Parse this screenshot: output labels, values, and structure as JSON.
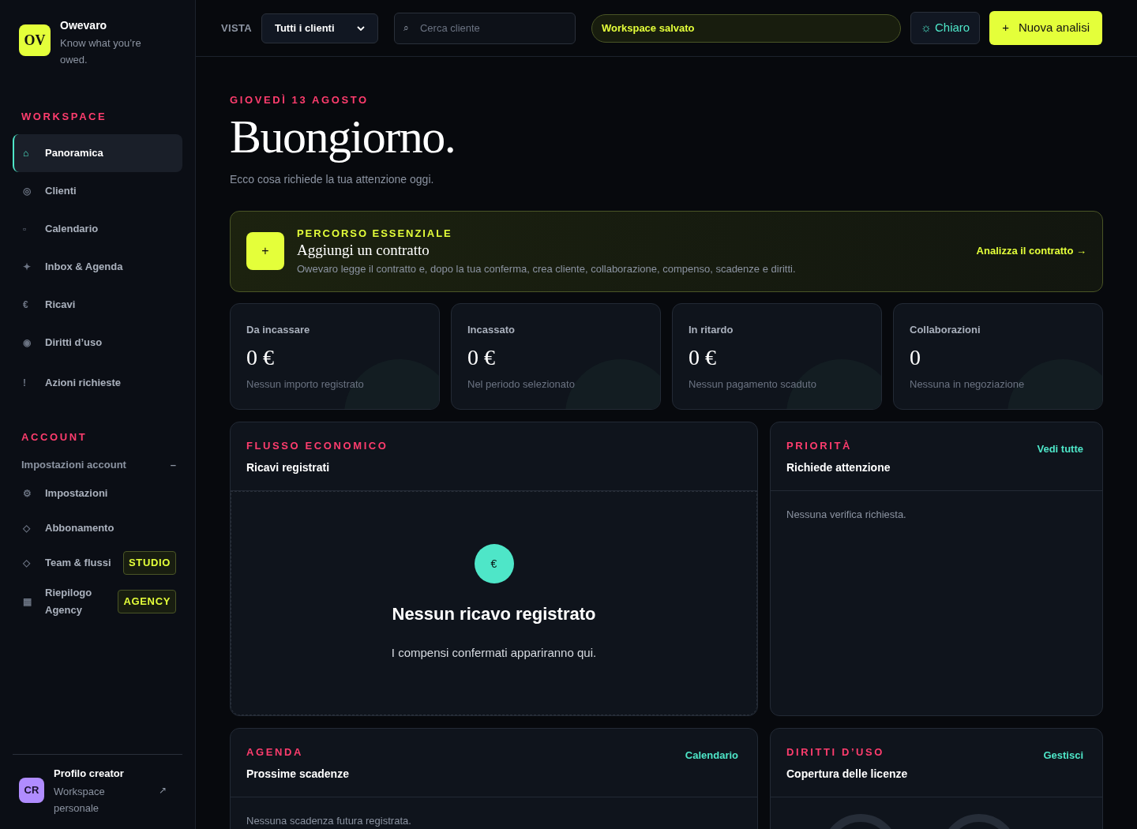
{
  "brand": {
    "logo": "OV",
    "name": "Owevaro",
    "tagline": "Know what you’re owed."
  },
  "sidebar": {
    "sections": [
      {
        "title": "WORKSPACE",
        "items": [
          {
            "icon": "⌂",
            "label": "Panoramica",
            "selected": true
          },
          {
            "icon": "◎",
            "label": "Clienti",
            "selected": false
          },
          {
            "icon": "▫",
            "label": "Calendario",
            "selected": false
          },
          {
            "icon": "✦",
            "label": "Inbox & Agenda",
            "selected": false
          },
          {
            "icon": "€",
            "label": "Ricavi",
            "selected": false
          },
          {
            "icon": "◉",
            "label": "Diritti d’uso",
            "selected": false
          },
          {
            "icon": "!",
            "label": "Azioni richieste",
            "selected": false
          }
        ]
      },
      {
        "title": "ACCOUNT",
        "group": {
          "label": "Impostazioni account",
          "toggle": "–"
        },
        "items": [
          {
            "icon": "⚙",
            "label": "Impostazioni",
            "selected": false
          },
          {
            "icon": "◇",
            "label": "Abbonamento",
            "selected": false
          },
          {
            "icon": "◇",
            "label": "Team & flussi",
            "badge": "STUDIO",
            "selected": false
          },
          {
            "icon": "▦",
            "label": "Riepilogo Agency",
            "badge": "AGENCY",
            "selected": false
          }
        ]
      }
    ],
    "profile": {
      "initials": "CR",
      "name": "Profilo creator",
      "subtitle": "Workspace personale",
      "action": "↗"
    }
  },
  "topbar": {
    "view_label": "VISTA",
    "view_select": "Tutti i clienti",
    "search": {
      "icon": "⌕",
      "placeholder": "Cerca cliente"
    },
    "status": "Workspace salvato",
    "theme_button": {
      "icon": "☼",
      "label": "Chiaro"
    },
    "primary_button": {
      "icon": "+",
      "label": "Nuova analisi"
    }
  },
  "greeting": {
    "date": "GIOVEDÌ 13 AGOSTO",
    "title": "Buongiorno.",
    "subtitle": "Ecco cosa richiede la tua attenzione oggi."
  },
  "onboarding": {
    "icon": "+",
    "eyebrow": "PERCORSO ESSENZIALE",
    "title": "Aggiungi un contratto",
    "text": "Owevaro legge il contratto e, dopo la tua conferma, crea cliente, collaborazione, compenso, scadenze e diritti.",
    "link": "Analizza il contratto →"
  },
  "stats": [
    {
      "label": "Da incassare",
      "value": "0 €",
      "note": "Nessun importo registrato"
    },
    {
      "label": "Incassato",
      "value": "0 €",
      "note": "Nel periodo selezionato"
    },
    {
      "label": "In ritardo",
      "value": "0 €",
      "note": "Nessun pagamento scaduto"
    },
    {
      "label": "Collaborazioni",
      "value": "0",
      "note": "Nessuna in negoziazione"
    }
  ],
  "panels": [
    {
      "kind": "empty_state",
      "eyebrow": "FLUSSO ECONOMICO",
      "title": "Ricavi registrati",
      "icon": "€",
      "empty_title": "Nessun ricavo registrato",
      "empty_text": "I compensi confermati appariranno qui."
    },
    {
      "kind": "message",
      "eyebrow": "PRIORITÀ",
      "title": "Richiede attenzione",
      "link": "Vedi tutte",
      "message": "Nessuna verifica richiesta."
    },
    {
      "kind": "message",
      "eyebrow": "AGENDA",
      "title": "Prossime scadenze",
      "link": "Calendario",
      "message": "Nessuna scadenza futura registrata."
    },
    {
      "kind": "rings",
      "eyebrow": "DIRITTI D’USO",
      "title": "Copertura delle licenze",
      "link": "Gestisci"
    }
  ]
}
